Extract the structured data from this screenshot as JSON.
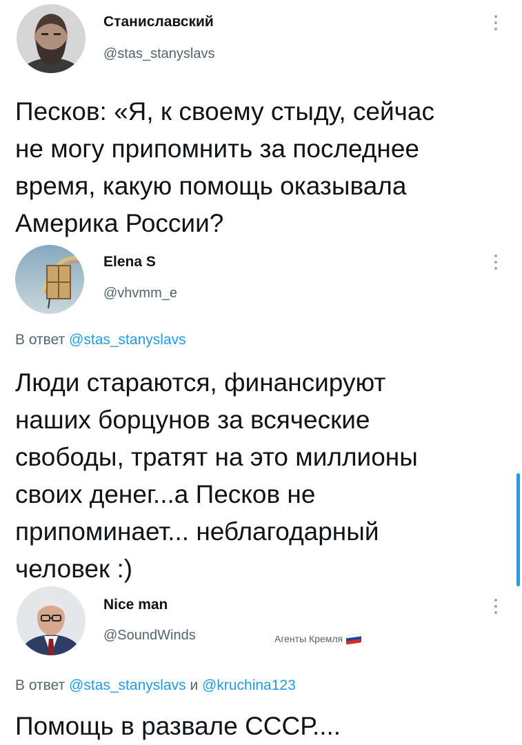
{
  "tweets": [
    {
      "author": "Станиславский",
      "handle": "@stas_stanyslavs",
      "avatar": "avatar-bearded-man",
      "text": "Песков: «Я, к своему стыду, сейчас\nне могу припомнить за последнее\nвремя, какую помощь оказывала\nАмерика России?"
    },
    {
      "author": "Elena S",
      "handle": "@vhvmm_e",
      "avatar": "avatar-window-with-rainbow",
      "reply_prefix": "В ответ",
      "reply_to": "@stas_stanyslavs",
      "text": "Люди стараются, финансируют\nнаших борцунов за всяческие\nсвободы, тратят на это миллионы\nсвоих денег...а Песков не\nприпоминает... неблагодарный\nчеловек :)"
    },
    {
      "author": "Nice man",
      "handle": "@SoundWinds",
      "avatar": "avatar-man-in-glasses-suit",
      "label": "Агенты Кремля",
      "label_icon": "russian-flag-icon",
      "reply_prefix": "В ответ",
      "reply_to": "@stas_stanyslavs",
      "reply_joiner": "и",
      "reply_to_2": "@kruchina123",
      "text": "Помощь в развале СССР...."
    }
  ],
  "colors": {
    "text": "#0f1419",
    "secondary": "#536471",
    "mention": "#1d9bf0",
    "scrollbar": "#1d9bf0"
  }
}
